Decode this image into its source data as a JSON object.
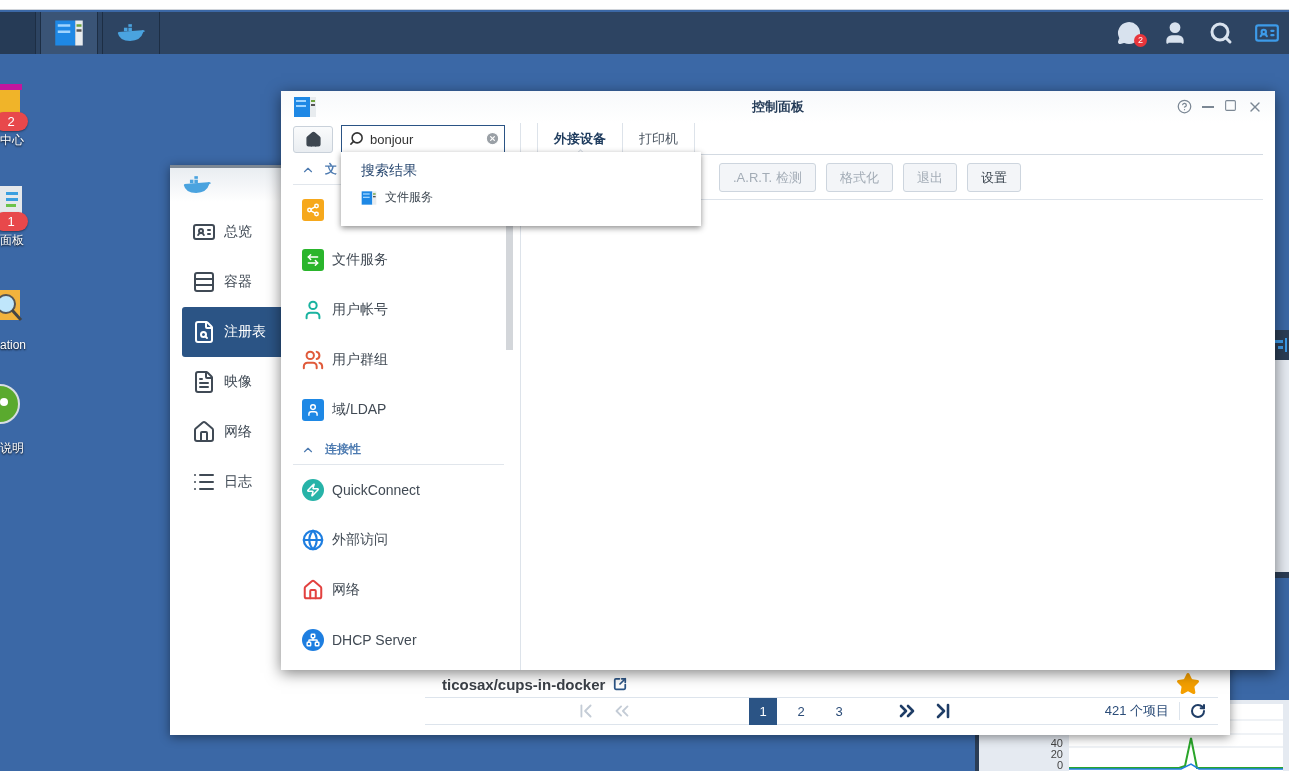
{
  "taskbar": {
    "apps": [
      {
        "kind": "control-panel",
        "selected": true
      },
      {
        "kind": "docker",
        "selected": false
      }
    ],
    "notification_badge": "2"
  },
  "desktop_icons": [
    {
      "kind": "bag",
      "label": "中心",
      "badge": "2"
    },
    {
      "kind": "panel",
      "label": "面板",
      "badge": "1"
    },
    {
      "kind": "search-folder",
      "label": "ation"
    },
    {
      "kind": "help",
      "label": "说明"
    }
  ],
  "docker_window": {
    "nav": [
      {
        "kind": "overview",
        "label": "总览",
        "selected": false
      },
      {
        "kind": "container",
        "label": "容器",
        "selected": false
      },
      {
        "kind": "registry",
        "label": "注册表",
        "selected": true
      },
      {
        "kind": "image",
        "label": "映像",
        "selected": false
      },
      {
        "kind": "network",
        "label": "网络",
        "selected": false
      },
      {
        "kind": "log",
        "label": "日志",
        "selected": false
      }
    ],
    "repo": {
      "name": "ticosax/cups-in-docker",
      "starred": true
    },
    "pagination": {
      "pages": [
        {
          "label": "1",
          "selected": true
        },
        {
          "label": "2",
          "selected": false
        },
        {
          "label": "3",
          "selected": false
        }
      ],
      "total": "421 个项目"
    }
  },
  "monitor": {
    "y_ticks": [
      "40",
      "20",
      "0"
    ]
  },
  "control_panel": {
    "title": "控制面板",
    "search": {
      "value": "bonjour"
    },
    "sections": [
      {
        "title": "文",
        "expanded": true,
        "items": [
          {
            "kind": "share"
          },
          {
            "kind": "file-services",
            "label": "文件服务"
          },
          {
            "kind": "user",
            "label": "用户帐号"
          },
          {
            "kind": "group",
            "label": "用户群组"
          },
          {
            "kind": "ldap",
            "label": "域/LDAP"
          }
        ]
      },
      {
        "title": "连接性",
        "expanded": true,
        "items": [
          {
            "kind": "quickconnect",
            "label": "QuickConnect"
          },
          {
            "kind": "external",
            "label": "外部访问"
          },
          {
            "kind": "network",
            "label": "网络"
          },
          {
            "kind": "dhcp",
            "label": "DHCP Server"
          }
        ]
      }
    ],
    "tabs": [
      {
        "label": "外接设备",
        "selected": true
      },
      {
        "label": "打印机",
        "selected": false
      }
    ],
    "toolbar": [
      {
        "label": ".A.R.T. 检测",
        "disabled": true
      },
      {
        "label": "格式化",
        "disabled": true
      },
      {
        "label": "退出",
        "disabled": true
      },
      {
        "label": "设置",
        "disabled": false
      }
    ],
    "search_results": {
      "title": "搜索结果",
      "items": [
        {
          "label": "文件服务"
        }
      ]
    }
  }
}
